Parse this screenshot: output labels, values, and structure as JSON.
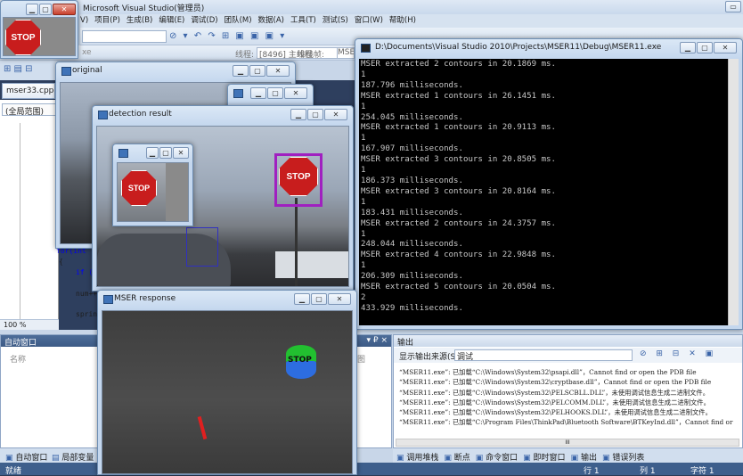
{
  "vs": {
    "title": "Microsoft Visual Studio(管理员)",
    "menu": [
      "V)",
      "项目(P)",
      "生成(B)",
      "编辑(E)",
      "调试(D)",
      "团队(M)",
      "数据(A)",
      "工具(T)",
      "测试(S)",
      "窗口(W)",
      "帮助(H)"
    ],
    "thread_label": "线程:",
    "thread_value": "[8496] 主线程",
    "stack_label": "堆栈帧:",
    "stack_value": "MSE",
    "config_value": "xe",
    "file_tab": "mser33.cpp",
    "scope": "(全局范围)",
    "code_lines": [
      "for(int",
      "{",
      "if (",
      "num++",
      "sprintf"
    ],
    "zoom": "100 %",
    "auto_panel": {
      "title": "自动窗口",
      "col_name": "名称",
      "pin": "▾ ₽ ×"
    },
    "output_panel": {
      "title": "输出",
      "source_label": "显示输出来源(S):",
      "source_value": "调试",
      "lines": [
        "“MSER11.exe”: 已加载“C:\\Windows\\System32\\psapi.dll”，Cannot find or open the PDB file",
        "“MSER11.exe”: 已加载“C:\\Windows\\System32\\cryptbase.dll”，Cannot find or open the PDB file",
        "“MSER11.exe”: 已加载“C:\\Windows\\System32\\PELSCBLL.DLL”，未使用调试信息生成二进制文件。",
        "“MSER11.exe”: 已加载“C:\\Windows\\System32\\PELCOMM.DLL”，未使用调试信息生成二进制文件。",
        "“MSER11.exe”: 已加载“C:\\Windows\\System32\\PELHOOKS.DLL”，未使用调试信息生成二进制文件。",
        "“MSER11.exe”: 已加载“C:\\Program Files\\ThinkPad\\Bluetooth Software\\BTKeyInd.dll”，Cannot find or"
      ],
      "scroll_mark": "III"
    },
    "bottom_tabs_left": [
      "自动窗口",
      "局部变量"
    ],
    "bottom_tabs_right": [
      "调用堆栈",
      "断点",
      "命令窗口",
      "即时窗口",
      "输出",
      "错误列表"
    ],
    "status": {
      "ready": "就绪",
      "row": "行 1",
      "col": "列 1",
      "char": "字符 1"
    },
    "partial_label": "图"
  },
  "console": {
    "title": "D:\\Documents\\Visual Studio 2010\\Projects\\MSER11\\Debug\\MSER11.exe",
    "lines": [
      "MSER extracted 2 contours in 20.1869 ms.",
      "1",
      "187.796 milliseconds.",
      "MSER extracted 1 contours in 26.1451 ms.",
      "1",
      "254.045 milliseconds.",
      "MSER extracted 1 contours in 20.9113 ms.",
      "1",
      "167.907 milliseconds.",
      "MSER extracted 3 contours in 20.8505 ms.",
      "1",
      "186.373 milliseconds.",
      "MSER extracted 3 contours in 20.8164 ms.",
      "1",
      "183.431 milliseconds.",
      "MSER extracted 2 contours in 24.3757 ms.",
      "1",
      "248.044 milliseconds.",
      "MSER extracted 4 contours in 22.9848 ms.",
      "1",
      "206.309 milliseconds.",
      "MSER extracted 5 contours in 20.0504 ms.",
      "2",
      "433.929 milliseconds."
    ]
  },
  "windows": {
    "original": {
      "title": "original"
    },
    "detection": {
      "title": "detection result"
    },
    "mser": {
      "title": "MSER response"
    },
    "stop_text": "STOP"
  },
  "colors": {
    "console_bg": "#000000",
    "detect_box": "#a020c0",
    "candidate_box": "#3030c0",
    "window_frame": "#c4d7ee"
  }
}
